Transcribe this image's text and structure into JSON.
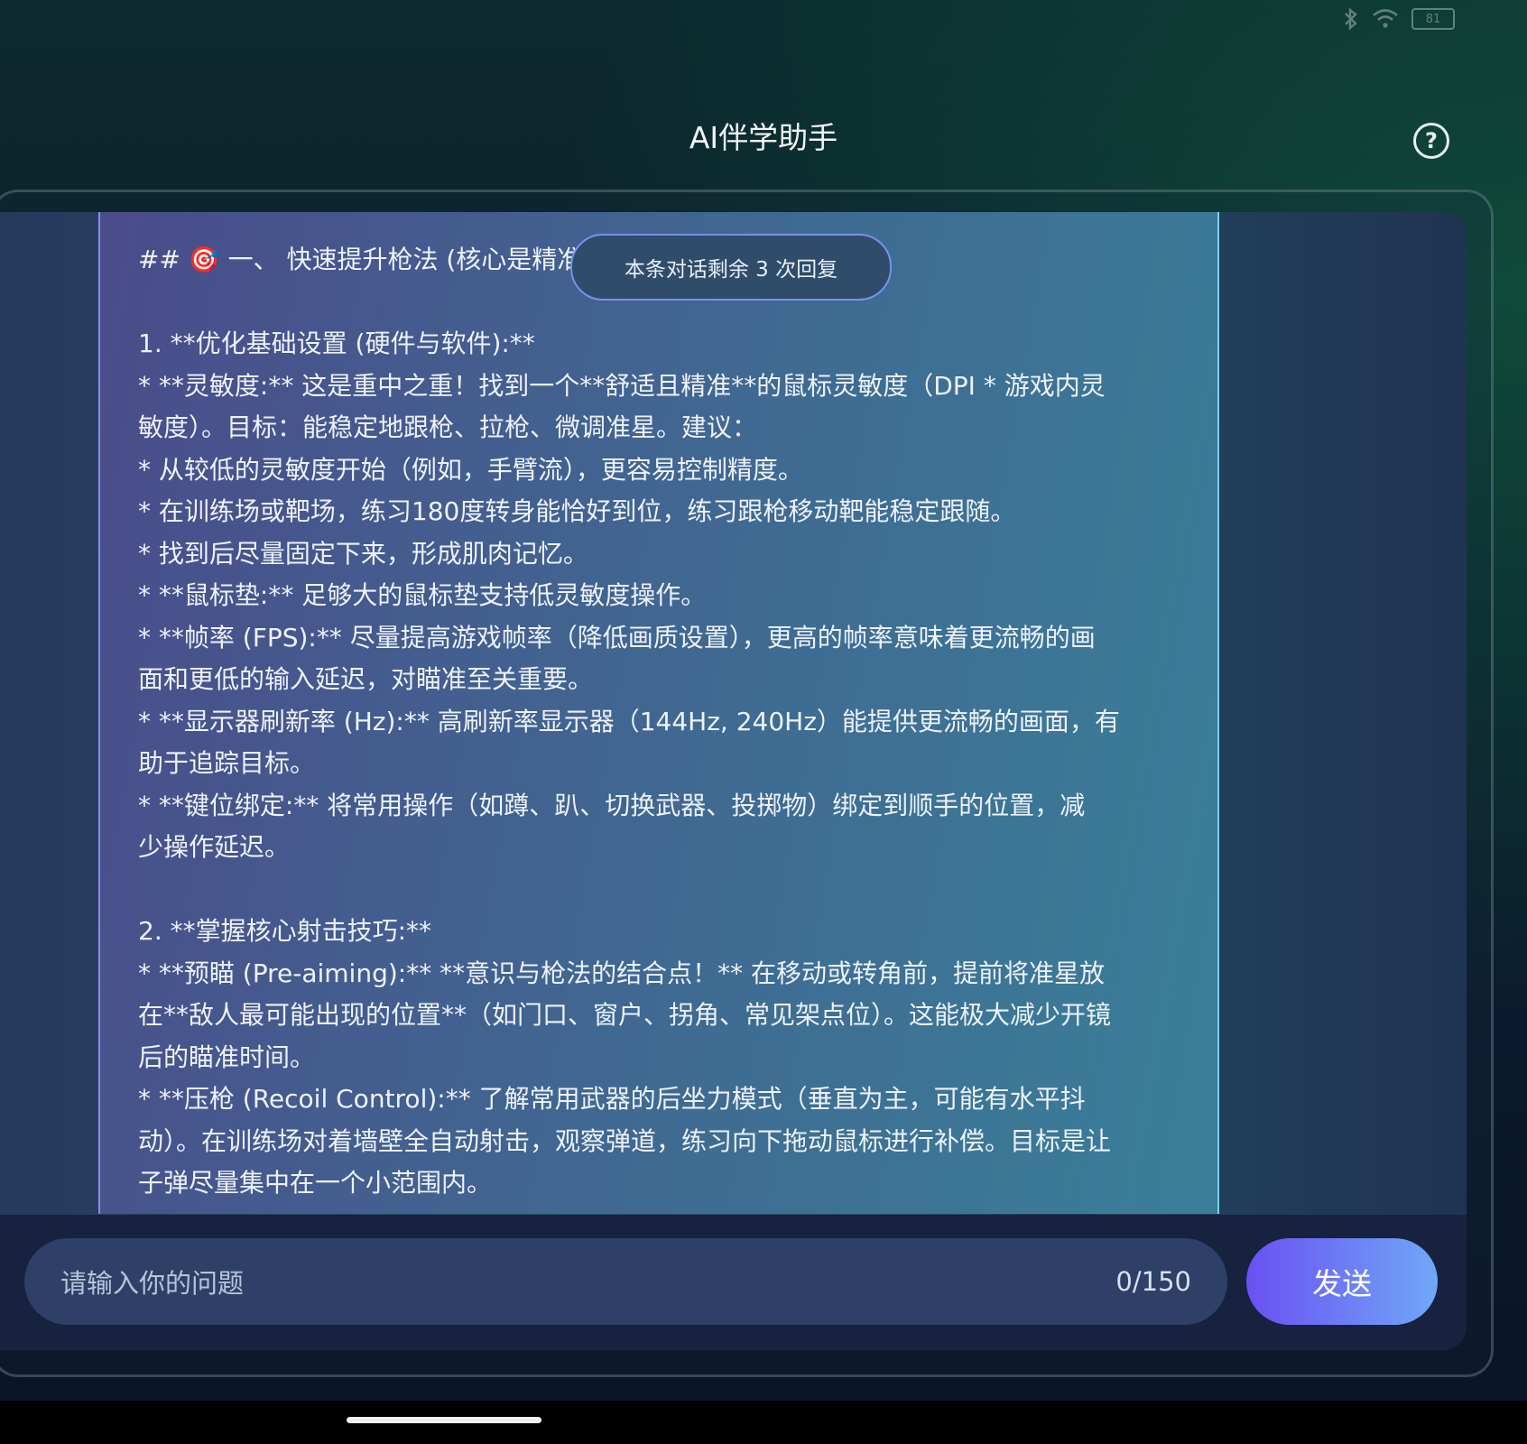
{
  "status_bar": {
    "battery": "81"
  },
  "header": {
    "title": "AI伴学助手"
  },
  "remaining_pill": "本条对话剩余 3 次回复",
  "message_lines": [
    "## 🎯 一、 快速提升枪法 (核心是精准)",
    "",
    "1.  **优化基础设置 (硬件与软件):**",
    "    *   **灵敏度:** 这是重中之重！找到一个**舒适且精准**的鼠标灵敏度（DPI * 游戏内灵",
    "敏度）。目标：能稳定地跟枪、拉枪、微调准星。建议：",
    "        *   从较低的灵敏度开始（例如，手臂流），更容易控制精度。",
    "        *   在训练场或靶场，练习180度转身能恰好到位，练习跟枪移动靶能稳定跟随。",
    "        *   找到后尽量固定下来，形成肌肉记忆。",
    "    *   **鼠标垫:** 足够大的鼠标垫支持低灵敏度操作。",
    "    *   **帧率 (FPS):** 尽量提高游戏帧率（降低画质设置），更高的帧率意味着更流畅的画",
    "面和更低的输入延迟，对瞄准至关重要。",
    "    *   **显示器刷新率 (Hz):** 高刷新率显示器（144Hz, 240Hz）能提供更流畅的画面，有",
    "助于追踪目标。",
    "    *   **键位绑定:** 将常用操作（如蹲、趴、切换武器、投掷物）绑定到顺手的位置，减",
    "少操作延迟。",
    "",
    "2.  **掌握核心射击技巧:**",
    "    *   **预瞄 (Pre-aiming):** **意识与枪法的结合点！** 在移动或转角前，提前将准星放",
    "在**敌人最可能出现的位置**（如门口、窗户、拐角、常见架点位）。这能极大减少开镜",
    "后的瞄准时间。",
    "    *   **压枪 (Recoil Control):** 了解常用武器的后坐力模式（垂直为主，可能有水平抖",
    "动）。在训练场对着墙壁全自动射击，观察弹道，练习向下拖动鼠标进行补偿。目标是让",
    "子弹尽量集中在一个小范围内。"
  ],
  "input": {
    "placeholder": "请输入你的问题",
    "counter": "0/150"
  },
  "send_label": "发送",
  "help_glyph": "?"
}
